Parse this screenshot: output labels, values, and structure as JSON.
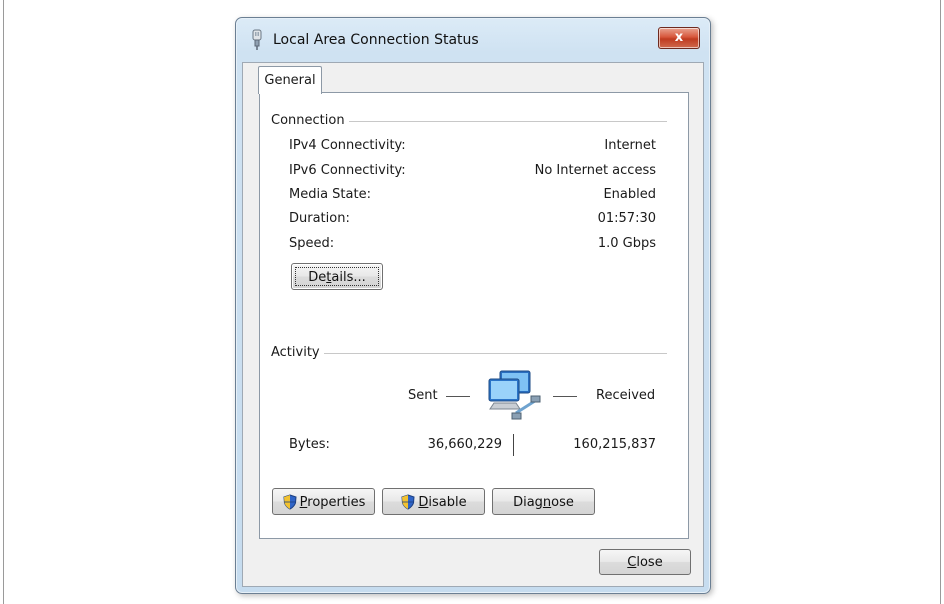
{
  "window": {
    "title": "Local Area Connection Status",
    "close_glyph": "x",
    "accent_color": "#c9def0"
  },
  "tabs": [
    {
      "label": "General",
      "selected": true
    }
  ],
  "connection": {
    "heading": "Connection",
    "rows": [
      {
        "label": "IPv4 Connectivity:",
        "value": "Internet"
      },
      {
        "label": "IPv6 Connectivity:",
        "value": "No Internet access"
      },
      {
        "label": "Media State:",
        "value": "Enabled"
      },
      {
        "label": "Duration:",
        "value": "01:57:30"
      },
      {
        "label": "Speed:",
        "value": "1.0 Gbps"
      }
    ],
    "details_button": {
      "pre": "De",
      "u": "t",
      "post": "ails..."
    }
  },
  "activity": {
    "heading": "Activity",
    "sent_label": "Sent",
    "received_label": "Received",
    "bytes_label": "Bytes:",
    "bytes_sent": "36,660,229",
    "bytes_received": "160,215,837",
    "icon": "network-computers-icon"
  },
  "buttons": {
    "properties": {
      "pre": "",
      "u": "P",
      "post": "roperties",
      "icon": "uac-shield-icon"
    },
    "disable": {
      "pre": "",
      "u": "D",
      "post": "isable",
      "icon": "uac-shield-icon"
    },
    "diagnose": {
      "pre": "Diag",
      "u": "n",
      "post": "ose"
    },
    "close": {
      "pre": "",
      "u": "C",
      "post": "lose"
    }
  }
}
